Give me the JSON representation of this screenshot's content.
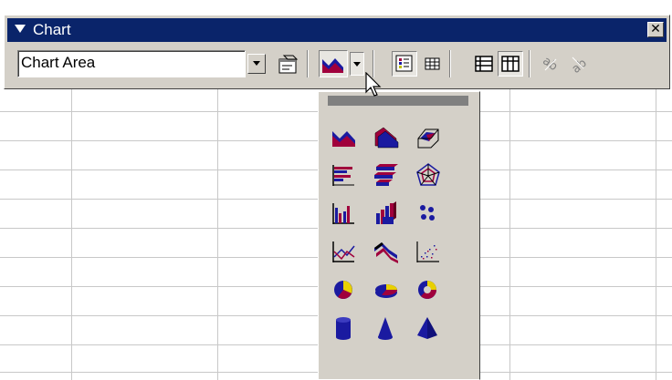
{
  "toolbar": {
    "title": "Chart",
    "object_select": {
      "value": "Chart Area"
    }
  },
  "palette": {
    "rows": [
      [
        "area-chart-icon",
        "3d-area-chart-icon",
        "3d-surface-chart-icon"
      ],
      [
        "bar-chart-icon",
        "3d-bar-chart-icon",
        "radar-chart-icon"
      ],
      [
        "column-chart-icon",
        "3d-column-chart-icon",
        "scatter-chart-icon"
      ],
      [
        "line-chart-icon",
        "3d-line-chart-icon",
        "scatter-dots-chart-icon"
      ],
      [
        "pie-chart-icon",
        "3d-pie-chart-icon",
        "doughnut-chart-icon"
      ],
      [
        "cylinder-chart-icon",
        "cone-chart-icon",
        "pyramid-chart-icon"
      ]
    ]
  },
  "colors": {
    "title_bar": "#0a246a",
    "face": "#d4d0c8",
    "red": "#a0003c",
    "blue": "#1a1aa0"
  }
}
